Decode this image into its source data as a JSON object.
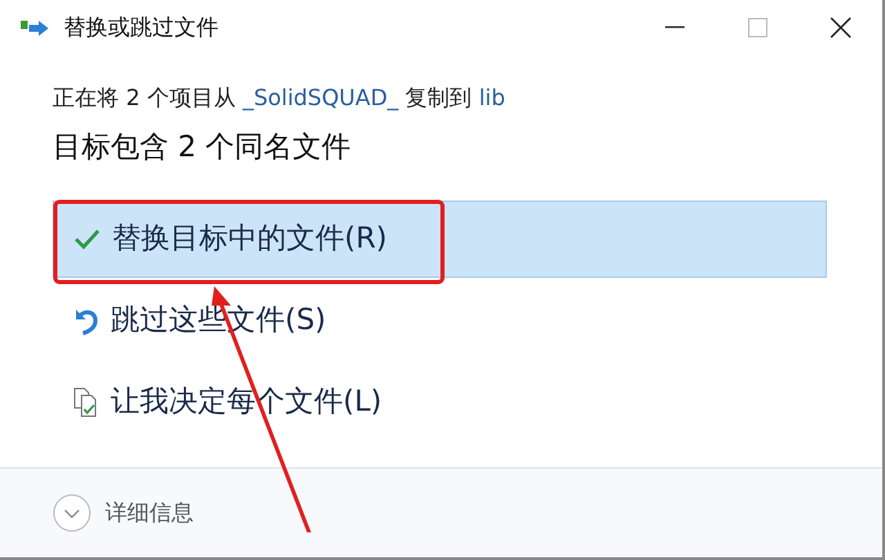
{
  "window": {
    "title": "替换或跳过文件"
  },
  "status": {
    "parts": [
      {
        "text": "正在将 2 个项目从 ",
        "kind": "plain"
      },
      {
        "text": "_SolidSQUAD_",
        "kind": "link"
      },
      {
        "text": " 复制到 ",
        "kind": "plain"
      },
      {
        "text": "lib",
        "kind": "link"
      }
    ]
  },
  "heading": "目标包含 2 个同名文件",
  "options": [
    {
      "label": "替换目标中的文件(R)",
      "kind": "replace",
      "selected": true
    },
    {
      "label": "跳过这些文件(S)",
      "kind": "skip",
      "selected": false
    },
    {
      "label": "让我决定每个文件(L)",
      "kind": "decide",
      "selected": false
    }
  ],
  "details": {
    "label": "详细信息",
    "expanded": false
  }
}
